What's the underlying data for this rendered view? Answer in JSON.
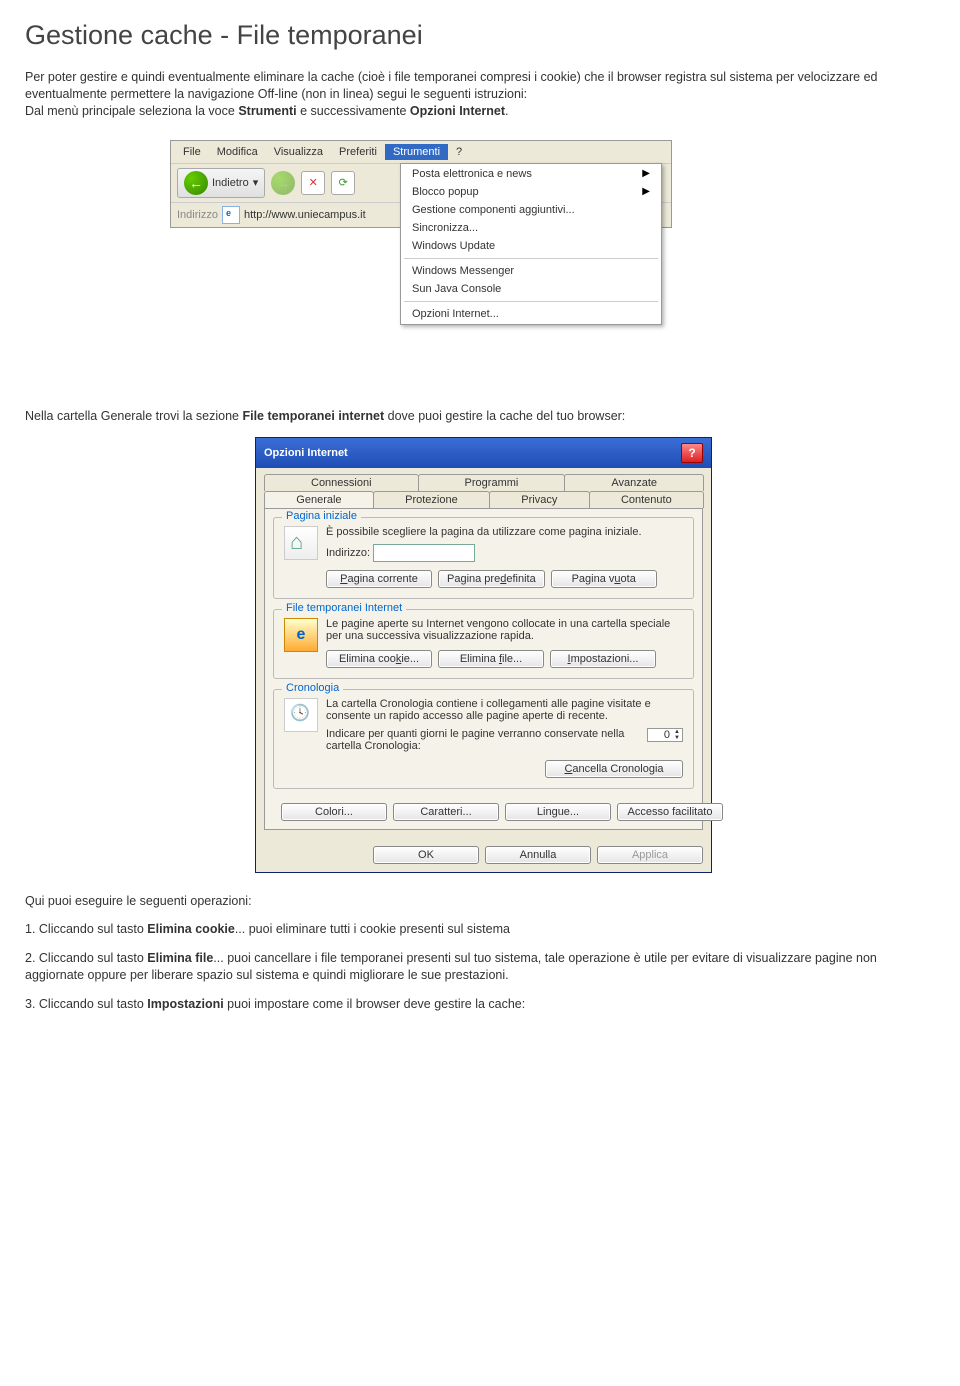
{
  "title": "Gestione cache - File temporanei",
  "intro_p1a": "Per poter gestire e quindi eventualmente eliminare la cache (cioè i file temporanei compresi i cookie) che il browser registra sul sistema per velocizzare ed eventualmente permettere la navigazione Off-line (non in linea) segui le seguenti istruzioni:",
  "intro_p1b_pre": "Dal menù principale seleziona la voce ",
  "intro_p1b_s1": "Strumenti",
  "intro_p1b_mid": " e successivamente ",
  "intro_p1b_s2": "Opzioni Internet",
  "intro_p1b_post": ".",
  "ie_menu": {
    "file": "File",
    "modifica": "Modifica",
    "visualizza": "Visualizza",
    "preferiti": "Preferiti",
    "strumenti": "Strumenti",
    "help": "?"
  },
  "toolbar": {
    "indietro": "Indietro"
  },
  "addr": {
    "label": "Indirizzo",
    "url": "http://www.uniecampus.it"
  },
  "menu_items": {
    "posta": "Posta elettronica e news",
    "blocco": "Blocco popup",
    "componenti": "Gestione componenti aggiuntivi...",
    "sincro": "Sincronizza...",
    "winupd": "Windows Update",
    "msgr": "Windows Messenger",
    "java": "Sun Java Console",
    "opzioni": "Opzioni Internet..."
  },
  "mid_p_pre": "Nella cartella Generale trovi la sezione ",
  "mid_p_s": "File temporanei internet",
  "mid_p_post": " dove puoi gestire la cache del tuo browser:",
  "opt": {
    "title": "Opzioni Internet",
    "tabs": {
      "conn": "Connessioni",
      "prog": "Programmi",
      "avan": "Avanzate",
      "gen": "Generale",
      "prot": "Protezione",
      "priv": "Privacy",
      "cont": "Contenuto"
    },
    "grp1": {
      "legend": "Pagina iniziale",
      "text": "È possibile scegliere la pagina da utilizzare come pagina iniziale.",
      "indirizzo": "Indirizzo:",
      "b1": "Pagina corrente",
      "b2": "Pagina predefinita",
      "b3": "Pagina vuota"
    },
    "grp2": {
      "legend": "File temporanei Internet",
      "text": "Le pagine aperte su Internet vengono collocate in una cartella speciale per una successiva visualizzazione rapida.",
      "b1": "Elimina cookie...",
      "b2": "Elimina file...",
      "b3": "Impostazioni..."
    },
    "grp3": {
      "legend": "Cronologia",
      "text": "La cartella Cronologia contiene i collegamenti alle pagine visitate e consente un rapido accesso alle pagine aperte di recente.",
      "days_q": "Indicare per quanti giorni le pagine verranno conservate nella cartella Cronologia:",
      "days_v": "0",
      "b1": "Cancella Cronologia"
    },
    "bottom": {
      "colori": "Colori...",
      "caratteri": "Caratteri...",
      "lingue": "Lingue...",
      "access": "Accesso facilitato"
    },
    "dlg": {
      "ok": "OK",
      "annulla": "Annulla",
      "applica": "Applica"
    }
  },
  "after_p": "Qui puoi eseguire le seguenti operazioni:",
  "op1_pre": "1. Cliccando sul tasto ",
  "op1_s": "Elimina cookie",
  "op1_post": "... puoi eliminare tutti i cookie presenti sul sistema",
  "op2_pre": "2. Cliccando sul tasto ",
  "op2_s": "Elimina file",
  "op2_post": "... puoi cancellare i file temporanei presenti sul tuo sistema, tale operazione è utile per evitare di visualizzare pagine non aggiornate oppure per liberare spazio sul sistema e quindi migliorare le sue prestazioni.",
  "op3_pre": "3. Cliccando sul tasto ",
  "op3_s": "Impostazioni",
  "op3_post": " puoi impostare come il browser deve gestire la cache:"
}
